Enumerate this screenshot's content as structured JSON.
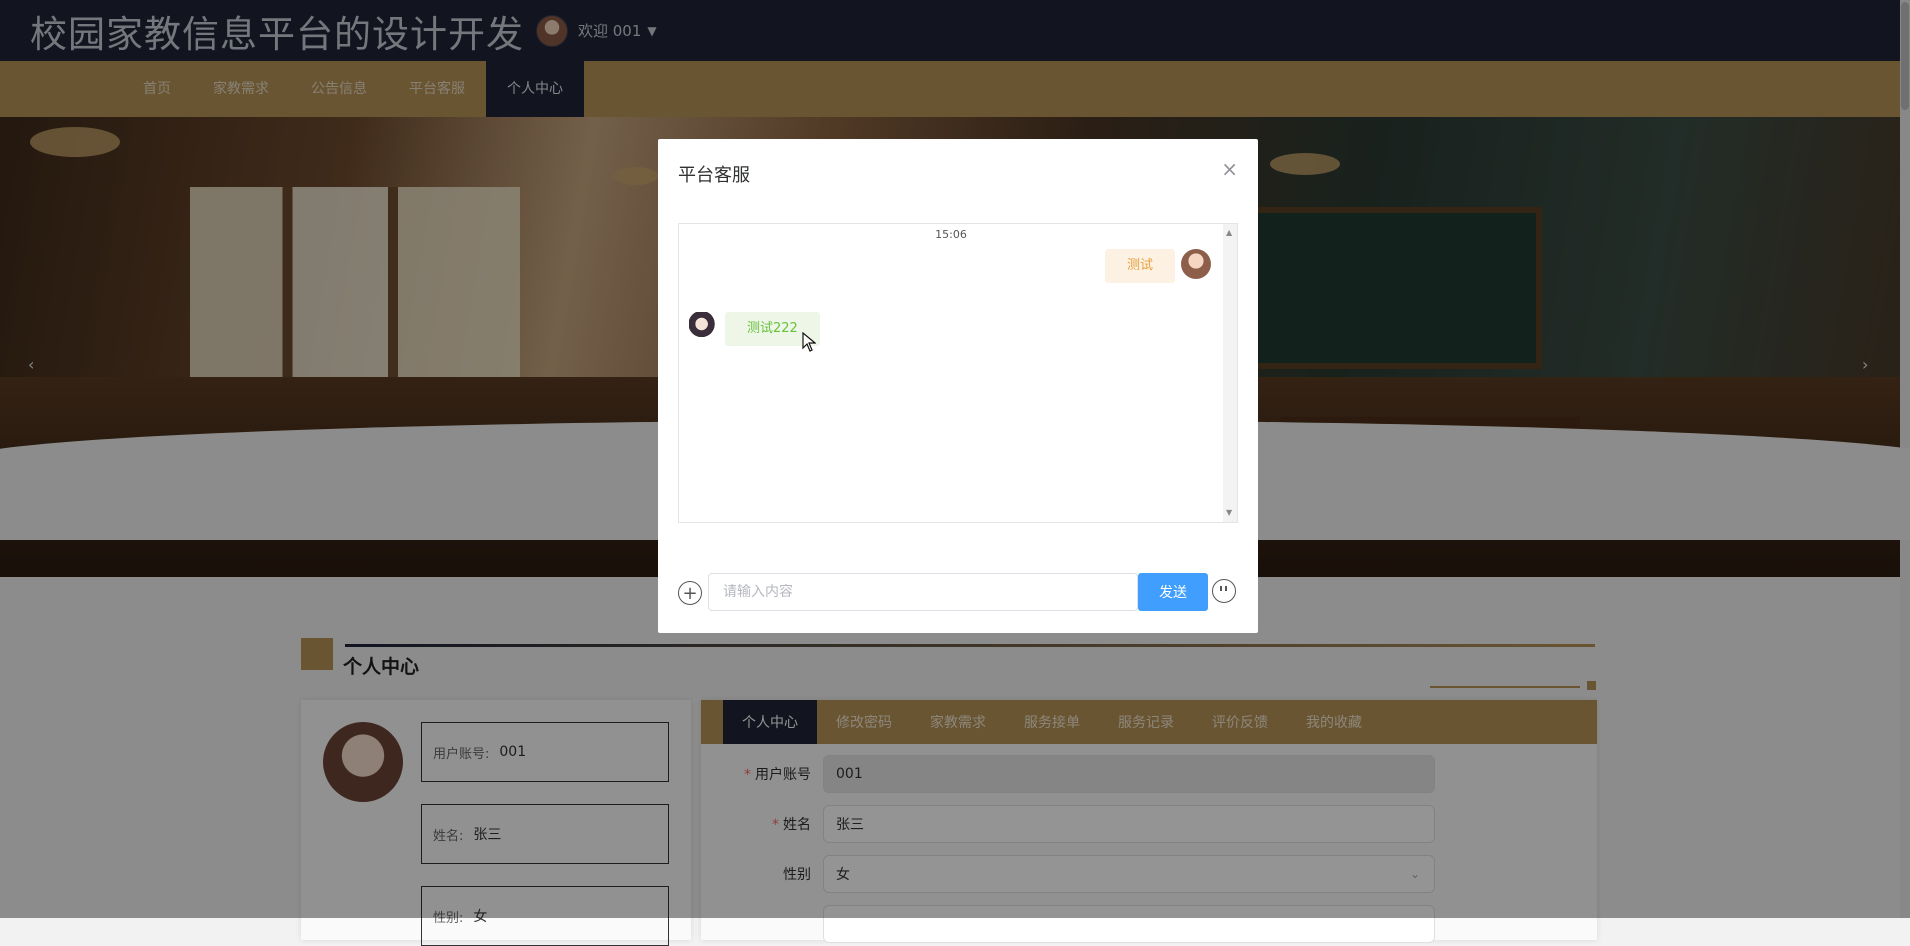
{
  "header": {
    "site_title": "校园家教信息平台的设计开发",
    "welcome": "欢迎 001",
    "caret": "▼"
  },
  "nav": {
    "items": [
      {
        "label": "首页"
      },
      {
        "label": "家教需求"
      },
      {
        "label": "公告信息"
      },
      {
        "label": "平台客服"
      },
      {
        "label": "个人中心",
        "active": true
      }
    ]
  },
  "banner": {
    "prev": "‹",
    "next": "›"
  },
  "section": {
    "title": "个人中心"
  },
  "profile": {
    "account_label": "用户账号:",
    "account_value": "001",
    "name_label": "姓名:",
    "name_value": "张三",
    "gender_label": "性别:",
    "gender_value": "女"
  },
  "tabs": [
    {
      "label": "个人中心",
      "active": true
    },
    {
      "label": "修改密码"
    },
    {
      "label": "家教需求"
    },
    {
      "label": "服务接单"
    },
    {
      "label": "服务记录"
    },
    {
      "label": "评价反馈"
    },
    {
      "label": "我的收藏"
    }
  ],
  "form": {
    "account_label": "用户账号",
    "account_value": "001",
    "name_label": "姓名",
    "name_value": "张三",
    "gender_label": "性别",
    "gender_value": "女",
    "required_mark": "*",
    "select_caret": "⌄"
  },
  "modal": {
    "title": "平台客服",
    "close": "×",
    "time": "15:06",
    "messages": [
      {
        "side": "right",
        "text": "测试"
      },
      {
        "side": "left",
        "text": "测试222"
      }
    ],
    "input_placeholder": "请输入内容",
    "send_label": "发送",
    "plus": "+",
    "scroll_up": "▲",
    "scroll_down": "▼"
  },
  "colors": {
    "header_bg": "#1f2538",
    "nav_bg": "#b69357",
    "send_button": "#409eff",
    "bubble_right_text": "#e6a23c",
    "bubble_left_text": "#67c23a"
  },
  "icons": [
    "avatar",
    "caret-down-icon",
    "close-icon",
    "plus-circle-icon",
    "emoji-icon",
    "select-caret-icon",
    "mouse-pointer-icon"
  ]
}
